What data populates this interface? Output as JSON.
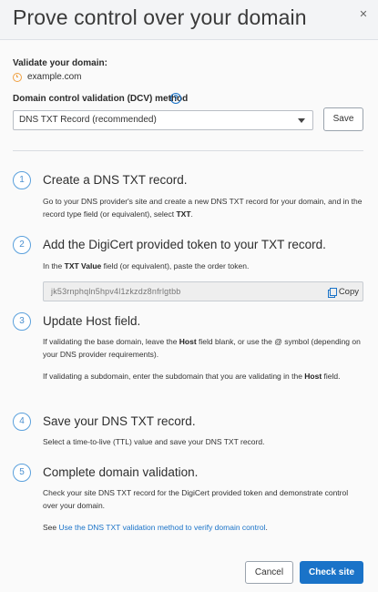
{
  "header": {
    "title": "Prove control over your domain",
    "close_icon": "close-icon"
  },
  "validate": {
    "label": "Validate your domain:",
    "domain": "example.com",
    "status_icon": "clock-icon",
    "status_color": "#f0a040"
  },
  "dcv": {
    "label": "Domain control validation (DCV) method",
    "help_icon": "?",
    "selected": "DNS TXT Record (recommended)",
    "save_label": "Save"
  },
  "steps": [
    {
      "num": "1",
      "title": "Create a DNS TXT record.",
      "text_a": "Go to your DNS provider's site and create a new DNS TXT record for your domain, and in the record type field (or equivalent), select ",
      "text_b": "TXT",
      "text_c": "."
    },
    {
      "num": "2",
      "title": "Add the DigiCert provided token to your TXT record.",
      "text_a": "In the ",
      "text_b": "TXT Value",
      "text_c": " field (or equivalent), paste the order token.",
      "token": "jk53rnphqln5hpv4l1zkzdz8nfrlgtbb",
      "copy_label": "Copy"
    },
    {
      "num": "3",
      "title": "Update Host field.",
      "p1_a": "If validating the base domain, leave the ",
      "p1_b": "Host",
      "p1_c": " field blank, or use the @ symbol (depending on your DNS provider requirements).",
      "p2_a": "If validating a subdomain, enter the subdomain that you are validating in the ",
      "p2_b": "Host",
      "p2_c": " field."
    },
    {
      "num": "4",
      "title": "Save your DNS TXT record.",
      "text": "Select a time-to-live (TTL) value and save your DNS TXT record."
    },
    {
      "num": "5",
      "title": "Complete domain validation.",
      "text": "Check your site DNS TXT record for the DigiCert provided token and demonstrate control over your domain.",
      "see_prefix": "See ",
      "see_link": "Use the DNS TXT validation method to verify domain control",
      "see_suffix": "."
    }
  ],
  "footer": {
    "cancel_label": "Cancel",
    "check_label": "Check site"
  },
  "colors": {
    "accent": "#1a73c8",
    "step_circle": "#5aa0dc"
  }
}
